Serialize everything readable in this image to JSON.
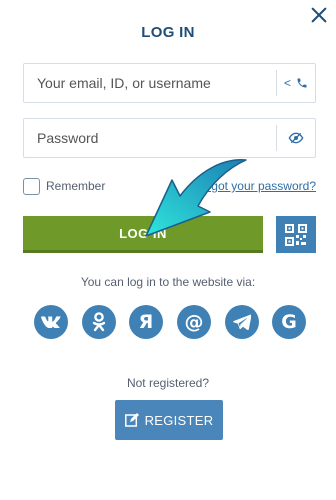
{
  "title": "LOG IN",
  "email_field": {
    "placeholder": "Your email, ID, or username",
    "addon_text": "<"
  },
  "password_field": {
    "placeholder": "Password"
  },
  "remember_label": "Remember",
  "forgot_password_link": "Forgot your password?",
  "login_button_label": "LOG IN",
  "social_login_text": "You can log in to the website via:",
  "social_providers": [
    "vk-icon",
    "odnoklassniki-icon",
    "yandex-icon",
    "at-icon",
    "telegram-icon",
    "google-icon"
  ],
  "not_registered_text": "Not registered?",
  "register_button_label": "REGISTER",
  "colors": {
    "title": "#1f4e7a",
    "login_button": "#6f9a2a",
    "social_icons": "#3f81b5",
    "register_button": "#4a86b9",
    "overlay_arrow": "#22c7d2"
  }
}
